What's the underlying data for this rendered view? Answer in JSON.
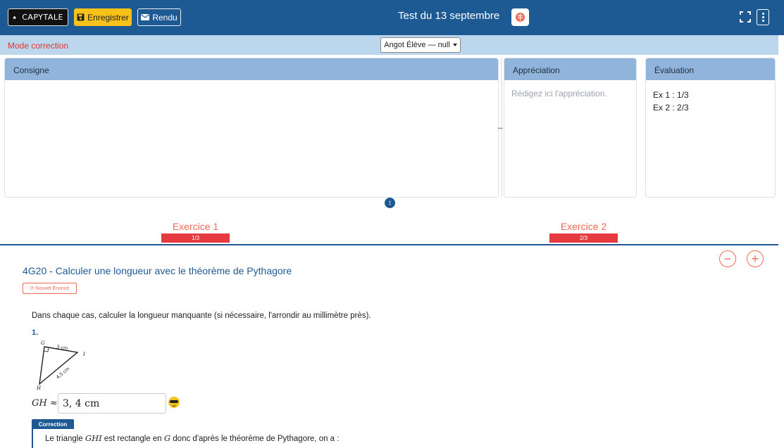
{
  "topbar": {
    "logo_label": "CAPYTALE",
    "save_label": "Enregistrer",
    "rendu_label": "Rendu",
    "title": "Test du 13 septembre",
    "color": "#1d5a94"
  },
  "modebar": {
    "mode_text": "Mode correction",
    "student_selected": "Angot Élève — null"
  },
  "panels": {
    "consigne_title": "Consigne",
    "appreciation_title": "Appréciation",
    "appreciation_placeholder": "Rédigez ici l'appréciation.",
    "evaluation_title": "Évaluation",
    "evaluation_lines": [
      "Ex 1 : 1/3",
      "Ex 2 : 2/3"
    ]
  },
  "exercises": [
    {
      "label": "Exercice 1",
      "score": "1/3"
    },
    {
      "label": "Exercice 2",
      "score": "2/3"
    }
  ],
  "zoom": {
    "minus": "−",
    "plus": "+"
  },
  "content": {
    "title": "4G20 - Calculer une longueur avec le théorème de Pythagore",
    "new_statement_label": "⟳ Nouvel Énoncé",
    "instruction": "Dans chaque cas, calculer la longueur manquante (si nécessaire, l'arrondir au millimètre près).",
    "question_number": "1.",
    "figure": {
      "vertex_g": "G",
      "vertex_h": "H",
      "vertex_i": "I",
      "side_gi": "3 cm",
      "side_hi": "4,5 cm"
    },
    "answer_label": "GH ≈",
    "answer_value": "3, 4 cm",
    "correction_tag": "Correction",
    "correction_text_1": "Le triangle ",
    "correction_math_1": "GHI",
    "correction_text_2": " est rectangle en ",
    "correction_math_2": "G",
    "correction_text_3": " donc d'après le théorème de Pythagore, on a :"
  }
}
